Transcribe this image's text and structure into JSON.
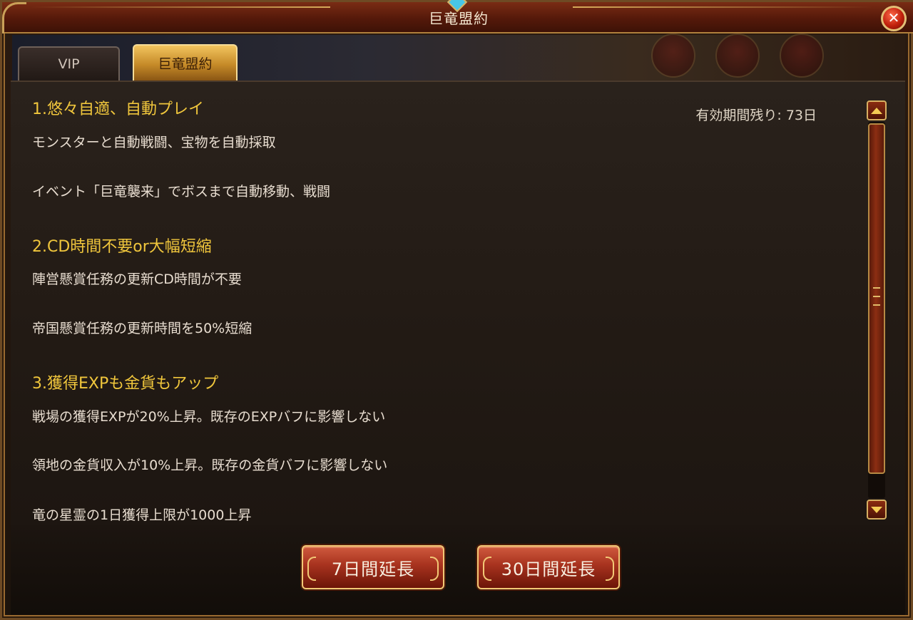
{
  "window": {
    "title": "巨竜盟約"
  },
  "tabs": [
    {
      "label": "VIP",
      "active": false
    },
    {
      "label": "巨竜盟約",
      "active": true
    }
  ],
  "remaining_label": "有効期間残り: 73日",
  "sections": [
    {
      "heading": "1.悠々自適、自動プレイ",
      "lines": [
        "モンスターと自動戦闘、宝物を自動採取",
        "イベント「巨竜襲来」でボスまで自動移動、戦闘"
      ]
    },
    {
      "heading": "2.CD時間不要or大幅短縮",
      "lines": [
        "陣営懸賞任務の更新CD時間が不要",
        "帝国懸賞任務の更新時間を50%短縮"
      ]
    },
    {
      "heading": "3.獲得EXPも金貨もアップ",
      "lines": [
        "戦場の獲得EXPが20%上昇。既存のEXPバフに影響しない",
        "領地の金貨収入が10%上昇。既存の金貨バフに影響しない",
        "竜の星霊の1日獲得上限が1000上昇"
      ]
    }
  ],
  "buttons": {
    "extend_7": "7日間延長",
    "extend_30": "30日間延長"
  },
  "colors": {
    "heading": "#f0c63c",
    "body_text": "#e8ddd0",
    "accent_gold": "#d7b062",
    "button_red": "#a7321e"
  },
  "icons": {
    "close": "close-icon",
    "scroll_up": "arrow-up-icon",
    "scroll_down": "arrow-down-icon"
  }
}
